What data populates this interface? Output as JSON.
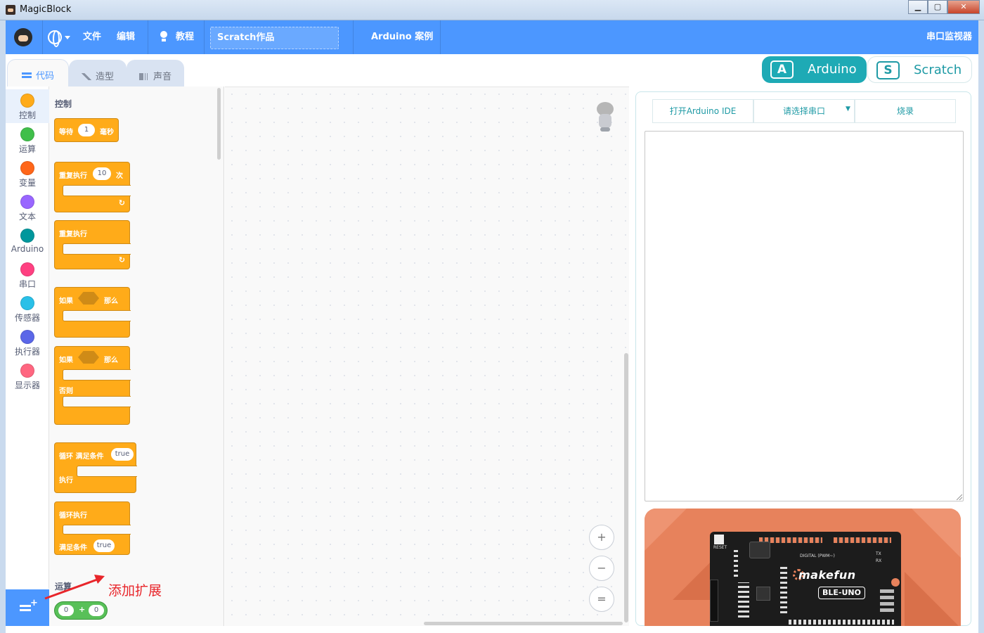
{
  "window": {
    "title": "MagicBlock",
    "buttons": [
      "minimize",
      "maximize",
      "close"
    ]
  },
  "menubar": {
    "language_icon": "globe-icon",
    "file": "文件",
    "edit": "编辑",
    "tutorial_icon": "lightbulb-icon",
    "tutorial": "教程",
    "project_title": "Scratch作品",
    "arduino_examples": "Arduino 案例",
    "serial_monitor": "串口监视器",
    "color": "#4c97ff"
  },
  "tabs": {
    "code": "代码",
    "costumes": "造型",
    "sounds": "声音"
  },
  "mode_switch": {
    "arduino": {
      "label": "Arduino",
      "icon_letter": "A",
      "color": "#1eaab5",
      "active": true
    },
    "scratch": {
      "label": "Scratch",
      "icon_letter": "S",
      "active": false
    }
  },
  "categories": [
    {
      "label": "控制",
      "color": "#ffab19"
    },
    {
      "label": "运算",
      "color": "#40bf4a"
    },
    {
      "label": "变量",
      "color": "#ff6619"
    },
    {
      "label": "文本",
      "color": "#9966ff"
    },
    {
      "label": "Arduino",
      "color": "#00979c"
    },
    {
      "label": "串口",
      "color": "#ff4081"
    },
    {
      "label": "传感器",
      "color": "#29c0e8"
    },
    {
      "label": "执行器",
      "color": "#5b67e8"
    },
    {
      "label": "显示器",
      "color": "#ff6680"
    }
  ],
  "flyout": {
    "section_control": "控制",
    "wait": {
      "text": "等待",
      "value": "1",
      "unit": "毫秒"
    },
    "repeat": {
      "text": "重复执行",
      "value": "10",
      "unit": "次"
    },
    "forever": "重复执行",
    "if_then": {
      "if": "如果",
      "then": "那么"
    },
    "if_else": {
      "if": "如果",
      "then": "那么",
      "else": "否则"
    },
    "while_loop": {
      "text": "循环 满足条件",
      "value": "true",
      "do": "执行"
    },
    "do_while": {
      "text": "循环执行",
      "until": "满足条件",
      "value": "true"
    },
    "section_operators": "运算",
    "add": {
      "a": "0",
      "op": "+",
      "b": "0"
    }
  },
  "extension": {
    "icon": "add-extension-icon",
    "annotation": "添加扩展"
  },
  "workspace": {
    "zoom_in": "+",
    "zoom_out": "−",
    "zoom_reset": "="
  },
  "right_panel": {
    "open_ide": "打开Arduino IDE",
    "select_port": "请选择串口",
    "upload": "烧录",
    "board": {
      "brand": "makefun",
      "model": "BLE-UNO",
      "reset": "RESET",
      "digital": "DIGITAL (PWM~)",
      "tx": "TX",
      "rx": "RX"
    }
  }
}
